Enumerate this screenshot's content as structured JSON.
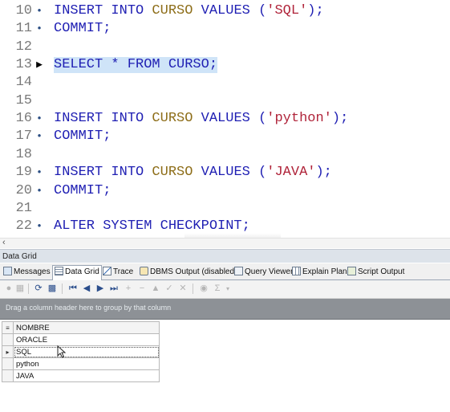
{
  "editor": {
    "lines": [
      {
        "num": "10",
        "marker": "dot",
        "tokens": [
          [
            "kw",
            "INSERT INTO "
          ],
          [
            "tbl",
            "CURSO"
          ],
          [
            "kw",
            " VALUES "
          ],
          [
            "pun",
            "("
          ],
          [
            "str",
            "'SQL'"
          ],
          [
            "pun",
            ");"
          ]
        ]
      },
      {
        "num": "11",
        "marker": "dot",
        "tokens": [
          [
            "kw",
            "COMMIT;"
          ]
        ]
      },
      {
        "num": "12",
        "marker": "",
        "tokens": []
      },
      {
        "num": "13",
        "marker": "arrow",
        "selected": true,
        "tokens": [
          [
            "kw",
            "SELECT * FROM CURSO;"
          ]
        ]
      },
      {
        "num": "14",
        "marker": "",
        "tokens": []
      },
      {
        "num": "15",
        "marker": "",
        "tokens": []
      },
      {
        "num": "16",
        "marker": "dot",
        "tokens": [
          [
            "kw",
            "INSERT INTO "
          ],
          [
            "tbl",
            "CURSO"
          ],
          [
            "kw",
            " VALUES "
          ],
          [
            "pun",
            "("
          ],
          [
            "str",
            "'python'"
          ],
          [
            "pun",
            ");"
          ]
        ]
      },
      {
        "num": "17",
        "marker": "dot",
        "tokens": [
          [
            "kw",
            "COMMIT;"
          ]
        ]
      },
      {
        "num": "18",
        "marker": "",
        "tokens": []
      },
      {
        "num": "19",
        "marker": "dot",
        "tokens": [
          [
            "kw",
            "INSERT INTO "
          ],
          [
            "tbl",
            "CURSO"
          ],
          [
            "kw",
            " VALUES "
          ],
          [
            "pun",
            "("
          ],
          [
            "str",
            "'JAVA'"
          ],
          [
            "pun",
            ");"
          ]
        ]
      },
      {
        "num": "20",
        "marker": "dot",
        "tokens": [
          [
            "kw",
            "COMMIT;"
          ]
        ]
      },
      {
        "num": "21",
        "marker": "",
        "tokens": []
      },
      {
        "num": "22",
        "marker": "dot",
        "tokens": [
          [
            "kw",
            "ALTER SYSTEM CHECKPOINT;"
          ]
        ]
      }
    ]
  },
  "panel": {
    "title": "Data Grid",
    "tabs": [
      {
        "label": "Messages",
        "icon": "messages-icon",
        "active": false
      },
      {
        "label": "Data Grid",
        "icon": "data-grid-icon",
        "active": true
      },
      {
        "label": "Trace",
        "icon": "trace-icon",
        "active": false
      },
      {
        "label": "DBMS Output (disabled)",
        "icon": "dbms-output-icon",
        "active": false
      },
      {
        "label": "Query Viewer",
        "icon": "query-viewer-icon",
        "active": false
      },
      {
        "label": "Explain Plan",
        "icon": "explain-plan-icon",
        "active": false
      },
      {
        "label": "Script Output",
        "icon": "script-output-icon",
        "active": false
      }
    ],
    "group_hint": "Drag a column header here to group by that column",
    "grid": {
      "column": "NOMBRE",
      "rows": [
        "ORACLE",
        "SQL",
        "python",
        "JAVA"
      ],
      "current_row": 1
    }
  },
  "colors": {
    "keyword": "#1f1fb3",
    "table_name": "#8d6d18",
    "string": "#b0243a",
    "selection": "#cfe4f8",
    "group_bar": "#8d9196"
  }
}
